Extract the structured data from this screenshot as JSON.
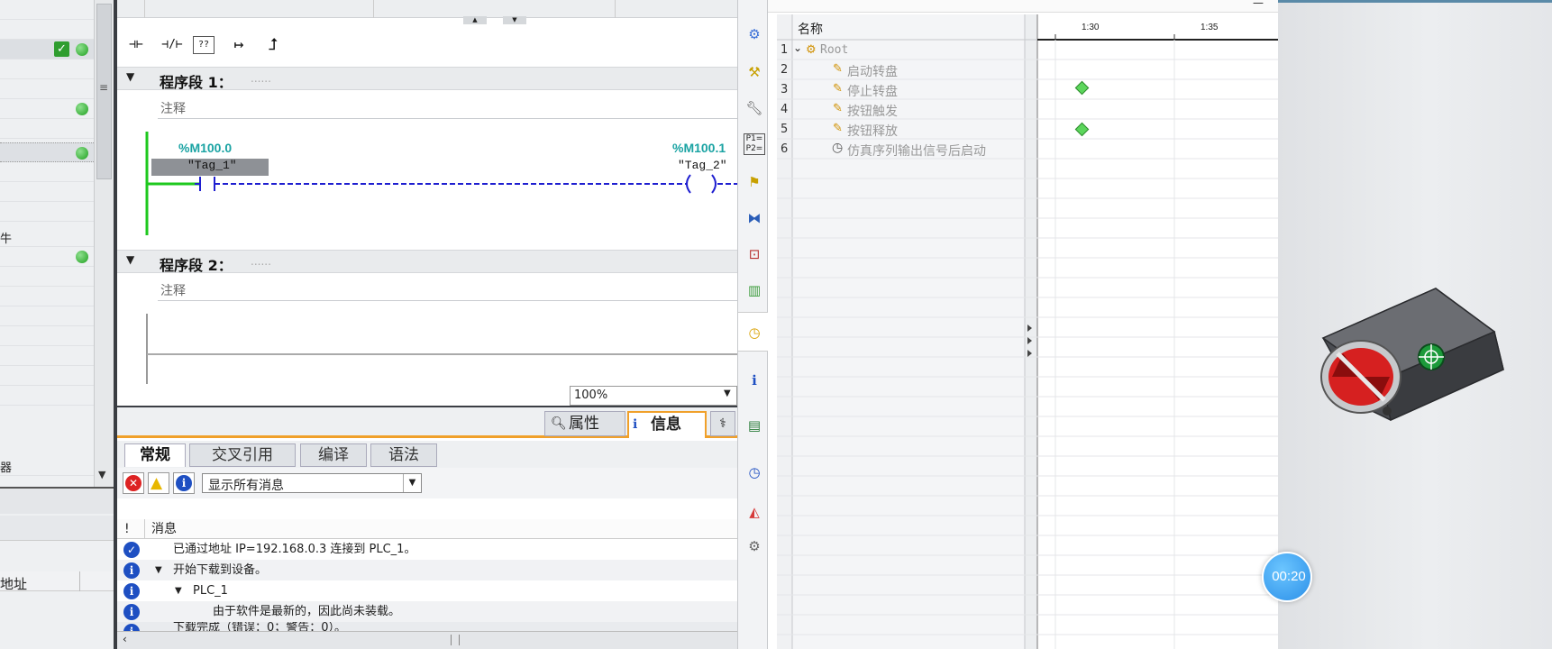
{
  "project_tree": {
    "labels": [
      "牛",
      "器",
      "地址"
    ]
  },
  "toolbar": {
    "buttons": [
      "⊣⊢",
      "⊣/⊢",
      "??",
      "↦",
      "⮥"
    ]
  },
  "network1": {
    "title": "程序段 1：",
    "dots": "......",
    "comment": "注释",
    "contact_addr": "%M100.0",
    "contact_tag": "\"Tag_1\"",
    "coil_addr": "%M100.1",
    "coil_tag": "\"Tag_2\""
  },
  "network2": {
    "title": "程序段 2：",
    "dots": "......",
    "comment": "注释"
  },
  "zoom": {
    "value": "100%"
  },
  "inspector": {
    "properties_label": "属性",
    "info_label": "信息",
    "tabs": [
      "常规",
      "交叉引用",
      "编译",
      "语法"
    ],
    "filter_value": "显示所有消息",
    "col_bang": "!",
    "col_message": "消息",
    "messages": [
      {
        "icon": "check",
        "text": "已通过地址 IP=192.168.0.3 连接到 PLC_1。",
        "indent": 0
      },
      {
        "icon": "info",
        "text": "开始下载到设备。",
        "indent": 1
      },
      {
        "icon": "info",
        "text": "PLC_1",
        "indent": 2
      },
      {
        "icon": "info",
        "text": "由于软件是最新的，因此尚未装载。",
        "indent": 3
      },
      {
        "icon": "info",
        "text": "下载完成（错误：0；警告：0）。",
        "indent": 1
      }
    ]
  },
  "sequence": {
    "col_name": "名称",
    "timeline_ticks": [
      "1:30",
      "1:35"
    ],
    "rows": [
      {
        "num": "1",
        "name": "Root"
      },
      {
        "num": "2",
        "name": "启动转盘"
      },
      {
        "num": "3",
        "name": "停止转盘"
      },
      {
        "num": "4",
        "name": "按钮触发"
      },
      {
        "num": "5",
        "name": "按钮释放"
      },
      {
        "num": "6",
        "name": "仿真序列输出信号后启动"
      }
    ]
  },
  "timer": {
    "value": "00:20"
  },
  "colors": {
    "tag_addr": "#1aa3a3",
    "wire_active": "#1ec81e",
    "wire_dash": "#1f1fd0",
    "accent_blue": "#2b8fe8",
    "info_blue": "#1e4fc2"
  }
}
